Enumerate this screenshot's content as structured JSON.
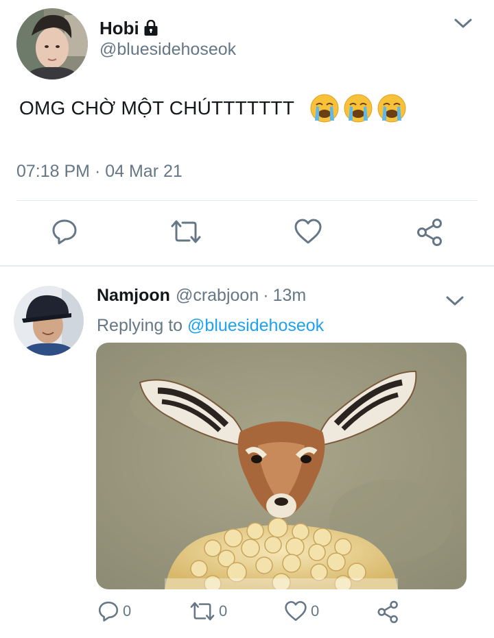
{
  "main_tweet": {
    "author": {
      "display_name": "Hobi",
      "handle": "@bluesidehoseok",
      "protected_icon": "lock-icon"
    },
    "text": "OMG CHỜ MỘT CHÚTTTTTTT",
    "emojis": [
      "loudly-crying-face",
      "loudly-crying-face",
      "loudly-crying-face"
    ],
    "timestamp": "07:18 PM · 04 Mar 21",
    "actions": [
      "reply-icon",
      "retweet-icon",
      "like-icon",
      "share-icon"
    ]
  },
  "reply_tweet": {
    "author": {
      "display_name": "Namjoon",
      "handle": "@crabjoon",
      "separator": "·",
      "time": "13m"
    },
    "replying_prefix": "Replying to",
    "replying_to": "@bluesidehoseok",
    "media_description_icon": "gif-antelope-popcorn",
    "counts": {
      "reply": "0",
      "retweet": "0",
      "like": "0"
    }
  },
  "colors": {
    "text_primary": "#14171a",
    "text_secondary": "#657786",
    "link": "#1da1f2",
    "divider": "#e1e8ed",
    "icon": "#657786"
  }
}
